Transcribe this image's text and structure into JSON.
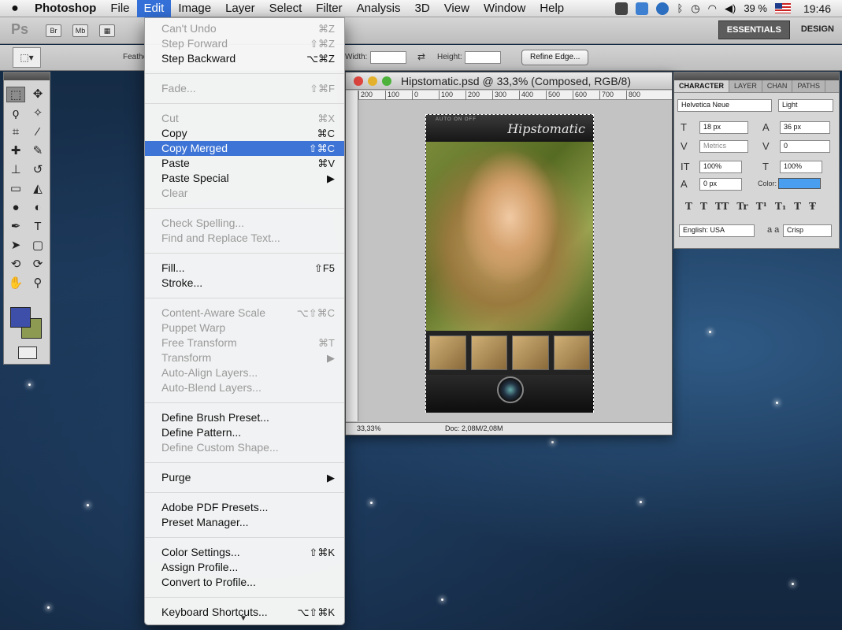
{
  "menubar": {
    "apple": "",
    "items": [
      "Photoshop",
      "File",
      "Edit",
      "Image",
      "Layer",
      "Select",
      "Filter",
      "Analysis",
      "3D",
      "View",
      "Window",
      "Help"
    ],
    "battery": "39 %",
    "clock": "19:46"
  },
  "appbar": {
    "ps_logo": "Ps",
    "bridge_btn": "Br",
    "minibridge_btn": "Mb",
    "workspaces": [
      "ESSENTIALS",
      "DESIGN"
    ]
  },
  "options": {
    "feather_label": "Feathe",
    "width_label": "Width:",
    "height_label": "Height:",
    "refine_button": "Refine Edge..."
  },
  "document": {
    "title": "Hipstomatic.psd @ 33,3% (Composed, RGB/8)",
    "ruler_ticks": [
      "200",
      "100",
      "0",
      "100",
      "200",
      "300",
      "400",
      "500",
      "600",
      "700",
      "800"
    ],
    "app_title": "Hipstomatic",
    "app_switch_labels": "AUTO  ON  OFF",
    "zoom": "33,33%",
    "doc_size": "Doc: 2,08M/2,08M"
  },
  "character_panel": {
    "tabs": [
      "CHARACTER",
      "LAYER",
      "CHAN",
      "PATHS"
    ],
    "font_family": "Helvetica Neue",
    "font_style": "Light",
    "font_size": "18 px",
    "leading": "36 px",
    "kerning": "Metrics",
    "tracking": "0",
    "vertical_scale": "100%",
    "horizontal_scale": "100%",
    "baseline_shift": "0 px",
    "color_label": "Color:",
    "style_buttons": [
      "T",
      "T",
      "TT",
      "Tr",
      "T¹",
      "T₁",
      "T",
      "Ŧ"
    ],
    "language": "English: USA",
    "aa_label": "a a",
    "antialias": "Crisp",
    "colors": {
      "text_color": "#4a9ef0"
    }
  },
  "edit_menu": {
    "groups": [
      [
        {
          "label": "Can't Undo",
          "shortcut": "⌘Z",
          "enabled": false
        },
        {
          "label": "Step Forward",
          "shortcut": "⇧⌘Z",
          "enabled": false
        },
        {
          "label": "Step Backward",
          "shortcut": "⌥⌘Z",
          "enabled": true
        }
      ],
      [
        {
          "label": "Fade...",
          "shortcut": "⇧⌘F",
          "enabled": false
        }
      ],
      [
        {
          "label": "Cut",
          "shortcut": "⌘X",
          "enabled": false
        },
        {
          "label": "Copy",
          "shortcut": "⌘C",
          "enabled": true
        },
        {
          "label": "Copy Merged",
          "shortcut": "⇧⌘C",
          "enabled": true,
          "highlighted": true
        },
        {
          "label": "Paste",
          "shortcut": "⌘V",
          "enabled": true
        },
        {
          "label": "Paste Special",
          "shortcut": "▶",
          "enabled": true
        },
        {
          "label": "Clear",
          "shortcut": "",
          "enabled": false
        }
      ],
      [
        {
          "label": "Check Spelling...",
          "shortcut": "",
          "enabled": false
        },
        {
          "label": "Find and Replace Text...",
          "shortcut": "",
          "enabled": false
        }
      ],
      [
        {
          "label": "Fill...",
          "shortcut": "⇧F5",
          "enabled": true
        },
        {
          "label": "Stroke...",
          "shortcut": "",
          "enabled": true
        }
      ],
      [
        {
          "label": "Content-Aware Scale",
          "shortcut": "⌥⇧⌘C",
          "enabled": false
        },
        {
          "label": "Puppet Warp",
          "shortcut": "",
          "enabled": false
        },
        {
          "label": "Free Transform",
          "shortcut": "⌘T",
          "enabled": false
        },
        {
          "label": "Transform",
          "shortcut": "▶",
          "enabled": false
        },
        {
          "label": "Auto-Align Layers...",
          "shortcut": "",
          "enabled": false
        },
        {
          "label": "Auto-Blend Layers...",
          "shortcut": "",
          "enabled": false
        }
      ],
      [
        {
          "label": "Define Brush Preset...",
          "shortcut": "",
          "enabled": true
        },
        {
          "label": "Define Pattern...",
          "shortcut": "",
          "enabled": true
        },
        {
          "label": "Define Custom Shape...",
          "shortcut": "",
          "enabled": false
        }
      ],
      [
        {
          "label": "Purge",
          "shortcut": "▶",
          "enabled": true
        }
      ],
      [
        {
          "label": "Adobe PDF Presets...",
          "shortcut": "",
          "enabled": true
        },
        {
          "label": "Preset Manager...",
          "shortcut": "",
          "enabled": true
        }
      ],
      [
        {
          "label": "Color Settings...",
          "shortcut": "⇧⌘K",
          "enabled": true
        },
        {
          "label": "Assign Profile...",
          "shortcut": "",
          "enabled": true
        },
        {
          "label": "Convert to Profile...",
          "shortcut": "",
          "enabled": true
        }
      ],
      [
        {
          "label": "Keyboard Shortcuts...",
          "shortcut": "⌥⇧⌘K",
          "enabled": true
        }
      ]
    ],
    "scroll_arrow": "▼"
  },
  "tools": {
    "colors": {
      "foreground": "#3d4fa8",
      "background": "#8d9a52"
    }
  }
}
